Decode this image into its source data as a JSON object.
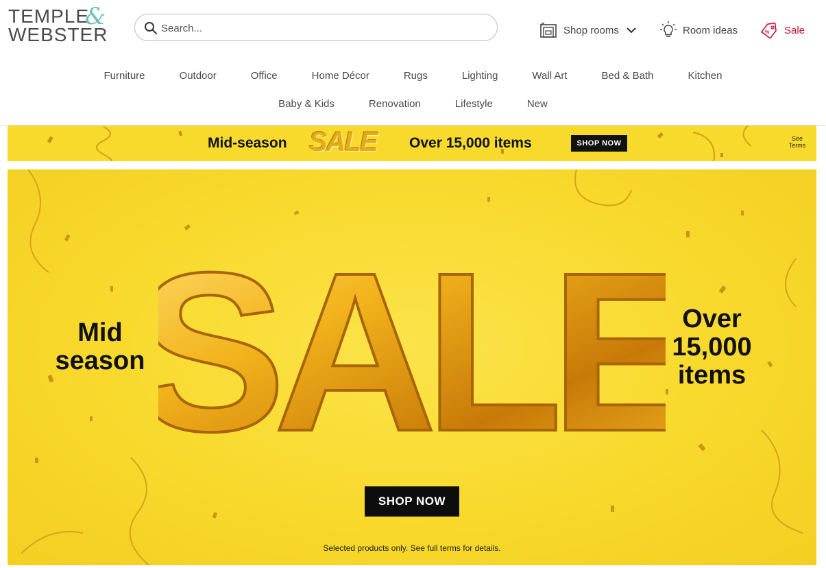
{
  "logo": {
    "line1": "TEMPLE",
    "line2": "WEBSTER",
    "amp": "&"
  },
  "search": {
    "placeholder": "Search..."
  },
  "header_links": {
    "shop_rooms": "Shop rooms",
    "room_ideas": "Room ideas",
    "sale": "Sale"
  },
  "nav": {
    "row1": [
      "Furniture",
      "Outdoor",
      "Office",
      "Home Décor",
      "Rugs",
      "Lighting",
      "Wall Art",
      "Bed & Bath",
      "Kitchen"
    ],
    "row2": [
      "Baby & Kids",
      "Renovation",
      "Lifestyle",
      "New"
    ]
  },
  "strip_banner": {
    "text_left": "Mid-season",
    "sale_word": "SALE",
    "text_right": "Over 15,000 items",
    "button": "SHOP NOW",
    "terms": "See Terms"
  },
  "hero": {
    "left_line1": "Mid",
    "left_line2": "season",
    "sale_word": "SALE",
    "right_line1": "Over",
    "right_line2": "15,000",
    "right_line3": "items",
    "button": "SHOP NOW",
    "disclaimer": "Selected products only. See full terms for details."
  },
  "colors": {
    "banner_yellow": "#f8da2c",
    "gold": "#e4ac1a",
    "sale_red": "#c8102e",
    "logo_accent": "#6cc1b6"
  }
}
